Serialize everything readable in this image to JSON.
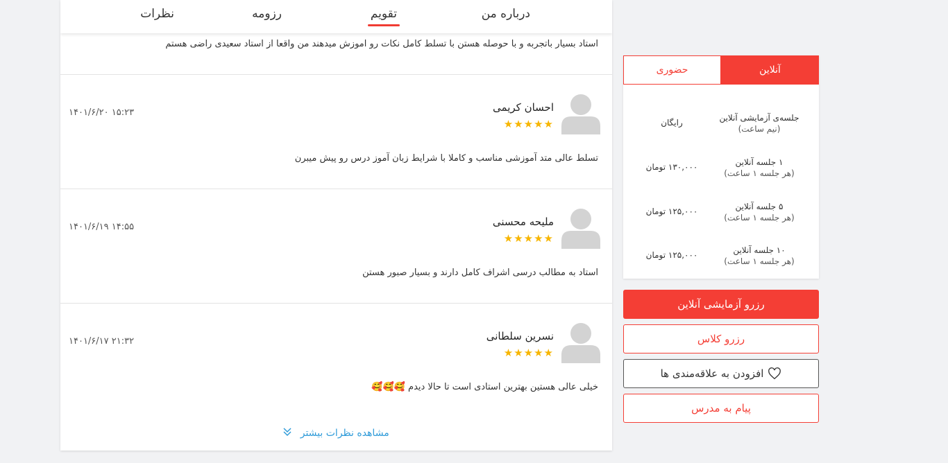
{
  "tabs": {
    "about": "درباره من",
    "calendar": "تقویم",
    "resume": "رزومه",
    "reviews": "نظرات"
  },
  "top_review_text": "استاد بسیار باتجربه و با حوصله هستن با تسلط کامل نکات رو اموزش میدهند من واقعا از استاد سعیدی راضی هستم",
  "reviews": [
    {
      "name": "احسان کریمی",
      "stars": "★★★★★",
      "date": "۱۴۰۱/۶/۲۰  ۱۵:۲۳",
      "text": "تسلط عالی متد آموزشی مناسب و کاملا با شرایط زبان آموز درس رو پیش میبرن"
    },
    {
      "name": "ملیحه محسنی",
      "stars": "★★★★★",
      "date": "۱۴۰۱/۶/۱۹  ۱۴:۵۵",
      "text": "استاد به مطالب درسی اشراف کامل دارند و بسیار صبور هستن"
    },
    {
      "name": "نسرین سلطانی",
      "stars": "★★★★★",
      "date": "۱۴۰۱/۶/۱۷  ۲۱:۳۲",
      "text": "خیلی عالی هستین بهترین استادی است تا حالا دیدم 🥰🥰🥰"
    }
  ],
  "more_reviews": "مشاهده نظرات بیشتر",
  "pricing": {
    "tab_online": "آنلاین",
    "tab_inperson": "حضوری",
    "rows": [
      {
        "label": "جلسه‌ی آزمایشی آنلاین",
        "sub": "(نیم ساعت)",
        "price": "رایگان"
      },
      {
        "label": "۱ جلسه آنلاین",
        "sub": "(هر جلسه ۱ ساعت)",
        "price": "۱۳۰,۰۰۰ تومان"
      },
      {
        "label": "۵ جلسه آنلاین",
        "sub": "(هر جلسه ۱ ساعت)",
        "price": "۱۲۵,۰۰۰ تومان"
      },
      {
        "label": "۱۰ جلسه آنلاین",
        "sub": "(هر جلسه ۱ ساعت)",
        "price": "۱۲۵,۰۰۰ تومان"
      }
    ]
  },
  "buttons": {
    "trial": "رزرو آزمایشی آنلاین",
    "class": "رزرو کلاس",
    "favorite": "افزودن به علاقه‌مندی ها",
    "message": "پیام به مدرس"
  },
  "colors": {
    "accent": "#f43e35",
    "star": "#f7b500",
    "link": "#2f9bd9"
  },
  "icons": {
    "avatar": "user-avatar-icon",
    "star": "star-icon",
    "more": "chevron-double-down-icon",
    "favorite": "heart-icon"
  }
}
